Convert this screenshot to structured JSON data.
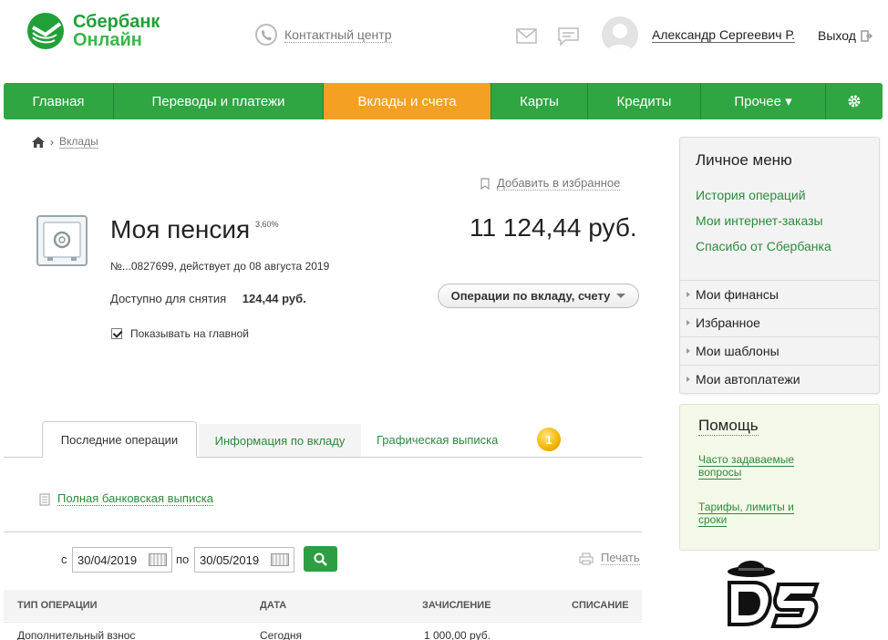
{
  "header": {
    "logo_line1": "Сбербанк",
    "logo_line2": "Онлайн",
    "contact_label": "Контактный центр",
    "user_name": "Александр Сергеевич Р.",
    "logout_label": "Выход"
  },
  "nav": {
    "items": [
      {
        "label": "Главная"
      },
      {
        "label": "Переводы и платежи"
      },
      {
        "label": "Вклады и счета"
      },
      {
        "label": "Карты"
      },
      {
        "label": "Кредиты"
      },
      {
        "label": "Прочее ▾"
      }
    ],
    "active_index": 2,
    "colors": {
      "bar": "#2fa642",
      "active": "#f4a022"
    }
  },
  "breadcrumb": {
    "current": "Вклады"
  },
  "favorite_label": "Добавить в избранное",
  "deposit": {
    "title": "Моя пенсия",
    "rate": "3,60%",
    "balance": "11 124,44 руб.",
    "account_info": "№...0827699, действует до 08 августа 2019",
    "available_label": "Доступно для снятия",
    "available_value": "124,44 руб.",
    "operations_button": "Операции по вкладу, счету",
    "show_on_main_label": "Показывать на главной",
    "show_on_main_checked": true
  },
  "tabs": [
    {
      "label": "Последние операции"
    },
    {
      "label": "Информация по вкладу"
    },
    {
      "label": "Графическая выписка"
    }
  ],
  "coin_badge": "1",
  "full_statement_label": "Полная банковская выписка",
  "filter": {
    "from_label": "с",
    "from_value": "30/04/2019",
    "to_label": "по",
    "to_value": "30/05/2019",
    "print_label": "Печать"
  },
  "table": {
    "headers": [
      "ТИП ОПЕРАЦИИ",
      "ДАТА",
      "ЗАЧИСЛЕНИЕ",
      "СПИСАНИЕ"
    ],
    "rows": [
      {
        "type": "Дополнительный взнос",
        "date": "Сегодня",
        "credit": "1 000,00 руб.",
        "debit": ""
      }
    ]
  },
  "sidebar": {
    "personal_menu_title": "Личное меню",
    "links": [
      "История операций",
      "Мои интернет-заказы",
      "Спасибо от Сбербанка"
    ],
    "sections": [
      "Мои финансы",
      "Избранное",
      "Мои шаблоны",
      "Мои автоплатежи"
    ]
  },
  "help": {
    "title": "Помощь",
    "faq": "Часто задаваемые вопросы",
    "tariffs": "Тарифы, лимиты и сроки"
  },
  "watermark_text": "DS"
}
